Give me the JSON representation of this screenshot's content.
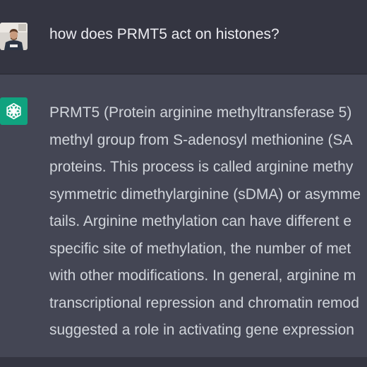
{
  "user_message": {
    "avatar": "user-avatar-photo",
    "text": "how does PRMT5 act on histones?"
  },
  "assistant_message": {
    "avatar": "openai-logo-icon",
    "lines": [
      "PRMT5 (Protein arginine methyltransferase 5)",
      "methyl group from S-adenosyl methionine (SA",
      "proteins. This process is called arginine methy",
      "symmetric dimethylarginine (sDMA) or asymme",
      "tails. Arginine methylation can have different e",
      "specific site of methylation, the number of met",
      "with other modifications. In general, arginine m",
      "transcriptional repression and chromatin remod",
      "suggested a role in activating gene expression"
    ]
  },
  "colors": {
    "background": "#343541",
    "assistant_background": "#444654",
    "logo_green": "#10a37f",
    "user_text": "#ececf1",
    "assistant_text": "#d1d5db"
  }
}
